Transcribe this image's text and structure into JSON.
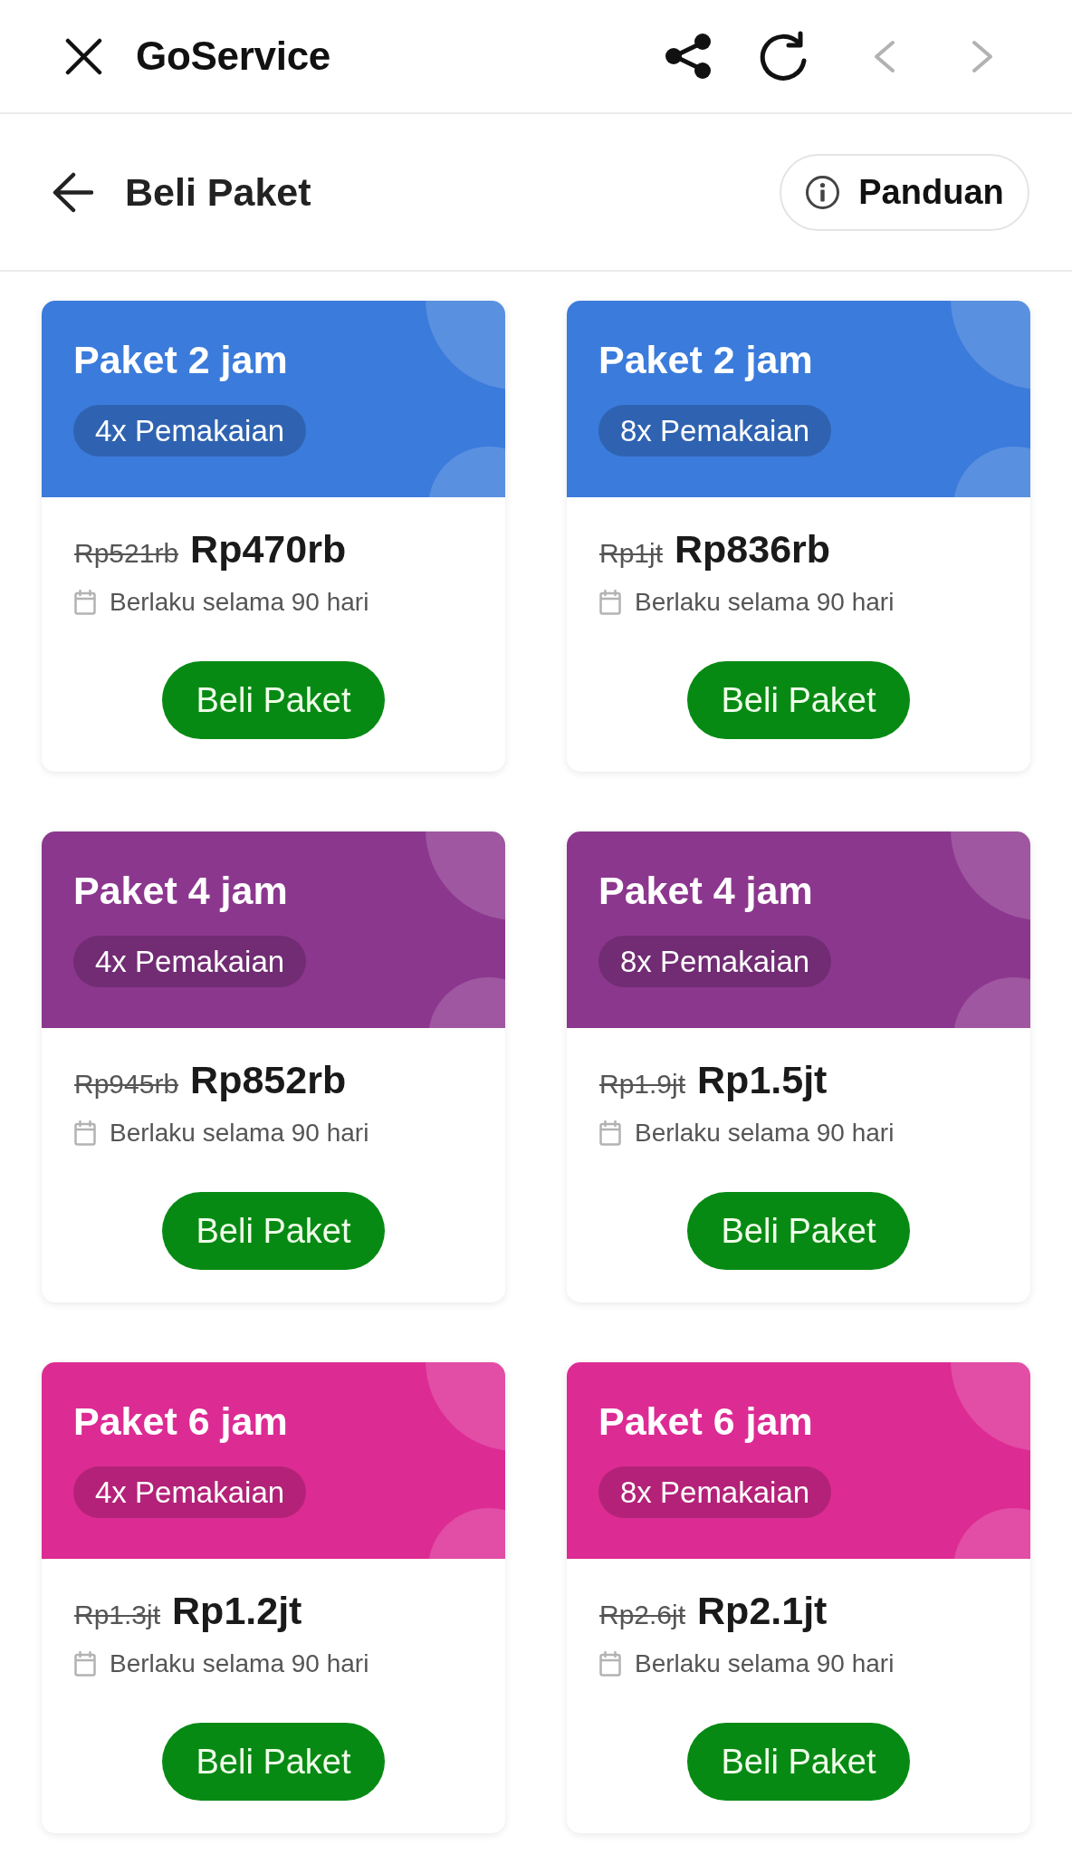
{
  "top_bar": {
    "title": "GoService",
    "nav_buttons": [
      {
        "kind": "back",
        "disabled": true
      },
      {
        "kind": "forward",
        "disabled": true
      }
    ]
  },
  "header": {
    "title": "Beli Paket",
    "guide_button": "Panduan"
  },
  "packages": [
    {
      "title": "Paket 2 jam",
      "usage": "4x Pemakaian",
      "color": "#3b7bdb",
      "original_price": "Rp521rb",
      "price": "Rp470rb",
      "validity": "Berlaku selama 90 hari",
      "button": "Beli Paket"
    },
    {
      "title": "Paket 2 jam",
      "usage": "8x Pemakaian",
      "color": "#3b7bdb",
      "original_price": "Rp1jt",
      "price": "Rp836rb",
      "validity": "Berlaku selama 90 hari",
      "button": "Beli Paket"
    },
    {
      "title": "Paket 4 jam",
      "usage": "4x Pemakaian",
      "color": "#8c378e",
      "original_price": "Rp945rb",
      "price": "Rp852rb",
      "validity": "Berlaku selama 90 hari",
      "button": "Beli Paket"
    },
    {
      "title": "Paket 4 jam",
      "usage": "8x Pemakaian",
      "color": "#8c378e",
      "original_price": "Rp1.9jt",
      "price": "Rp1.5jt",
      "validity": "Berlaku selama 90 hari",
      "button": "Beli Paket"
    },
    {
      "title": "Paket 6 jam",
      "usage": "4x Pemakaian",
      "color": "#dd2b94",
      "original_price": "Rp1.3jt",
      "price": "Rp1.2jt",
      "validity": "Berlaku selama 90 hari",
      "button": "Beli Paket"
    },
    {
      "title": "Paket 6 jam",
      "usage": "8x Pemakaian",
      "color": "#dd2b94",
      "original_price": "Rp2.6jt",
      "price": "Rp2.1jt",
      "validity": "Berlaku selama 90 hari",
      "button": "Beli Paket"
    }
  ]
}
